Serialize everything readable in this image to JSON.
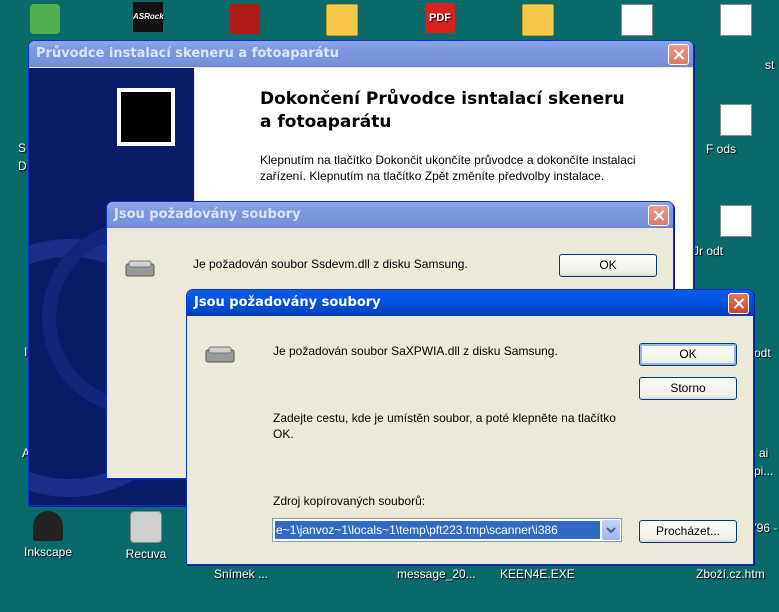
{
  "desktop": {
    "icons": [
      {
        "label": "Inkscape"
      },
      {
        "label": "Recuva"
      },
      {
        "label": "Snímek ..."
      },
      {
        "label": "message_20..."
      },
      {
        "label": "KEEN4E.EXE"
      },
      {
        "label": "Zboží.cz.htm"
      }
    ],
    "partial_labels": {
      "right_1": "st",
      "right_2": "F    ods",
      "right_3": "Jr    odt",
      "right_4": "odt",
      "right_5": "ai",
      "right_6": "pi...",
      "right_7": "796 -",
      "left_1": "S",
      "left_2": "D",
      "left_3": "I",
      "left_4": "A"
    },
    "top_icons": [
      "ASRock",
      "PDF"
    ]
  },
  "wizard": {
    "title": "Průvodce instalací skeneru a fotoaparátu",
    "heading": "Dokončení Průvodce isntalací skeneru a fotoaparátu",
    "body": "Klepnutím na tlačítko Dokončit ukončíte průvodce a dokončíte instalaci zařízení. Klepnutím na tlačítko Zpět změníte předvolby instalace."
  },
  "dialog1": {
    "title": "Jsou požadovány soubory",
    "message": "Je požadován soubor Ssdevm.dll z disku Samsung.",
    "ok_label": "OK"
  },
  "dialog2": {
    "title": "Jsou požadovány soubory",
    "message": "Je požadován soubor SaXPWIA.dll z disku Samsung.",
    "instruction": "Zadejte cestu, kde je umístěn soubor, a poté klepněte na tlačítko OK.",
    "source_label": "Zdroj kopírovaných souborů:",
    "source_value": "e~1\\janvoz~1\\locals~1\\temp\\pft223.tmp\\scanner\\i386",
    "ok_label": "OK",
    "cancel_label": "Storno",
    "browse_label": "Procházet..."
  }
}
